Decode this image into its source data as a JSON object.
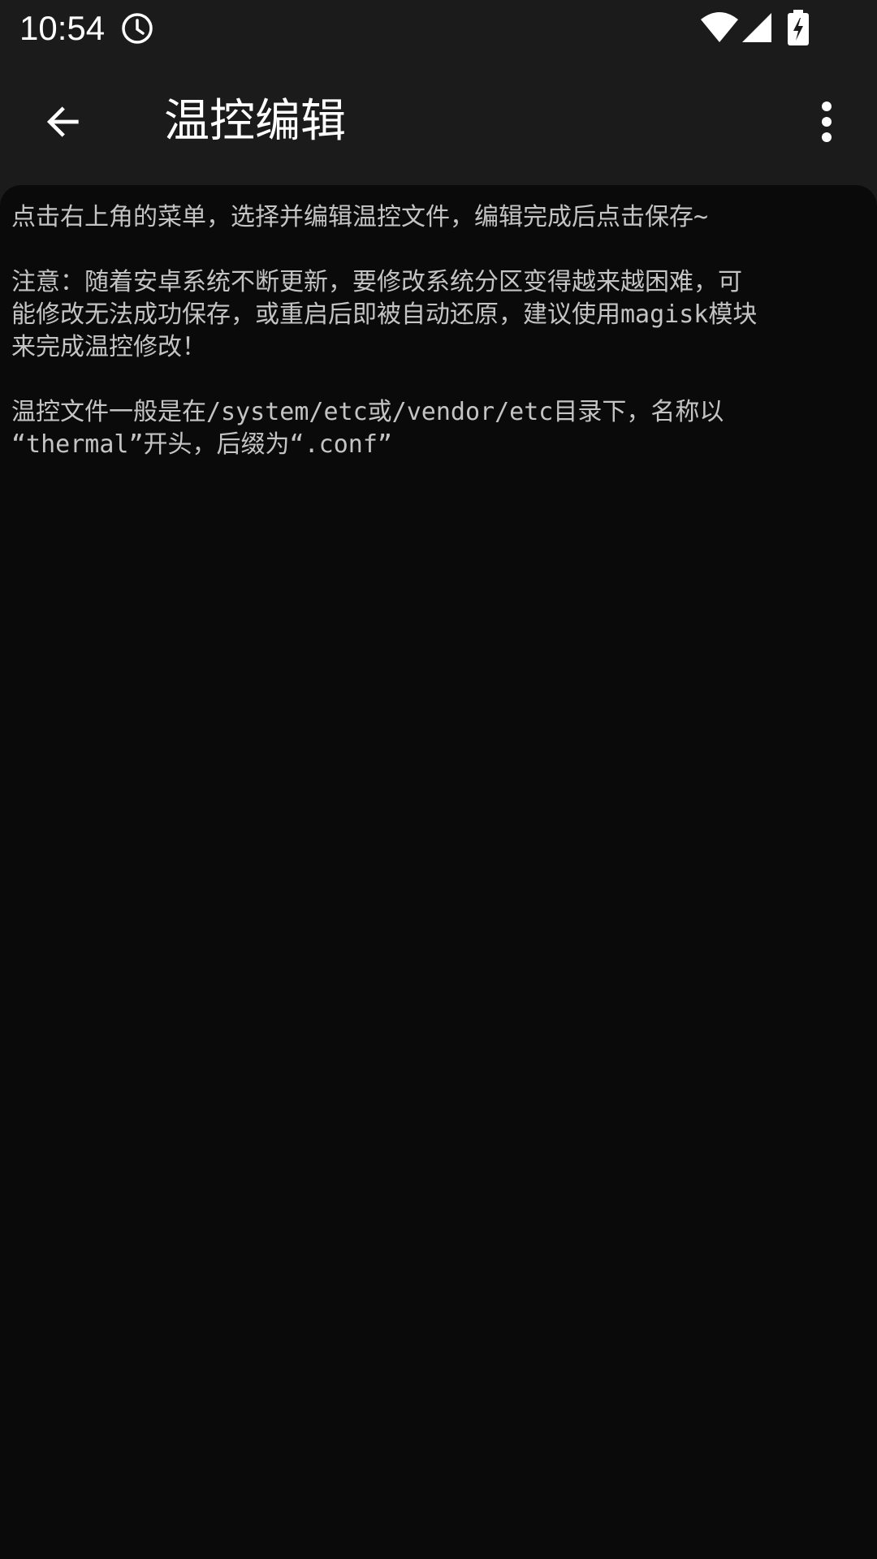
{
  "status_bar": {
    "time": "10:54",
    "icons": [
      "alarm-icon",
      "wifi-icon",
      "cellular-signal-icon",
      "battery-charging-icon"
    ]
  },
  "app_bar": {
    "title": "温控编辑",
    "back_icon": "arrow-back-icon",
    "menu_icon": "more-vert-icon"
  },
  "content": {
    "lines": [
      "点击右上角的菜单，选择并编辑温控文件，编辑完成后点击保存~",
      "",
      "注意：随着安卓系统不断更新，要修改系统分区变得越来越困难，可",
      "能修改无法成功保存，或重启后即被自动还原，建议使用magisk模块",
      "来完成温控修改！",
      "",
      "温控文件一般是在/system/etc或/vendor/etc目录下，名称以",
      "“thermal”开头，后缀为“.conf”"
    ]
  },
  "colors": {
    "app_bar_bg": "#1b1b1b",
    "content_bg": "#0a0a0a",
    "text": "#c4c4c4",
    "title": "#ffffff"
  }
}
